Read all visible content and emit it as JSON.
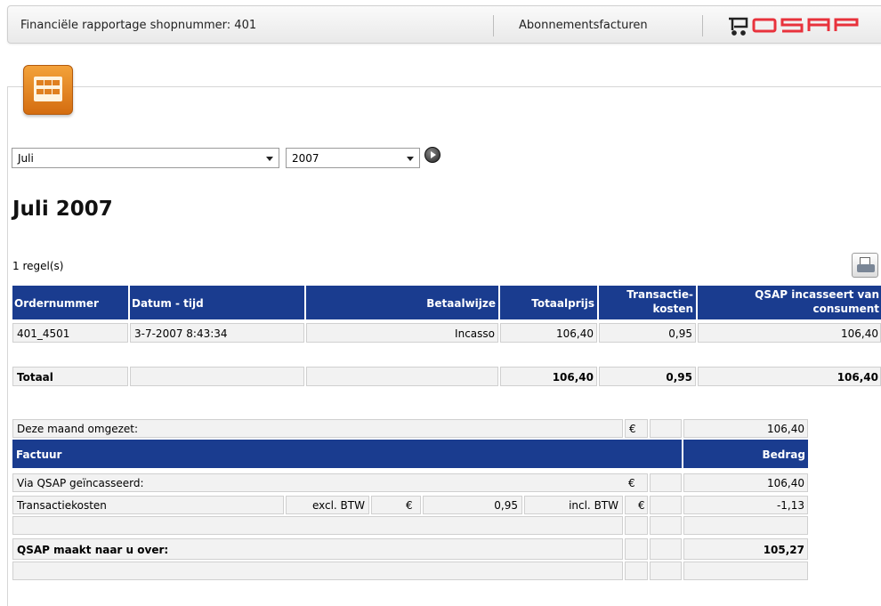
{
  "header": {
    "title": "Financiële rapportage shopnummer: 401",
    "link_label": "Abonnementsfacturen",
    "logo_text": "QSAP"
  },
  "filters": {
    "month": "Juli",
    "year": "2007"
  },
  "page_title": "Juli 2007",
  "row_count": "1 regel(s)",
  "orders_table": {
    "headers": {
      "order": "Ordernummer",
      "datetime": "Datum - tijd",
      "payment": "Betaalwijze",
      "total": "Totaalprijs",
      "costs_line1": "Transactie-",
      "costs_line2": "kosten",
      "collected_line1": "QSAP incasseert van",
      "collected_line2": "consument"
    },
    "rows": [
      {
        "order": "401_4501",
        "datetime": "3-7-2007 8:43:34",
        "payment": "Incasso",
        "total": "106,40",
        "costs": "0,95",
        "collected": "106,40"
      }
    ],
    "totals": {
      "label": "Totaal",
      "total": "106,40",
      "costs": "0,95",
      "collected": "106,40"
    }
  },
  "summary": {
    "turnover_label": "Deze maand omgezet:",
    "currency": "€",
    "turnover_value": "106,40",
    "invoice_header": "Factuur",
    "amount_header": "Bedrag",
    "collected_label": "Via QSAP geïncasseerd:",
    "collected_value": "106,40",
    "tx_label": "Transactiekosten",
    "excl_label": "excl. BTW",
    "excl_value": "0,95",
    "incl_label": "incl. BTW",
    "tx_value": "-1,13",
    "payout_label": "QSAP maakt naar u over:",
    "payout_value": "105,27"
  },
  "colors": {
    "header_blue": "#1a3c8f",
    "accent_orange": "#e08020",
    "logo_red": "#e8323c"
  }
}
